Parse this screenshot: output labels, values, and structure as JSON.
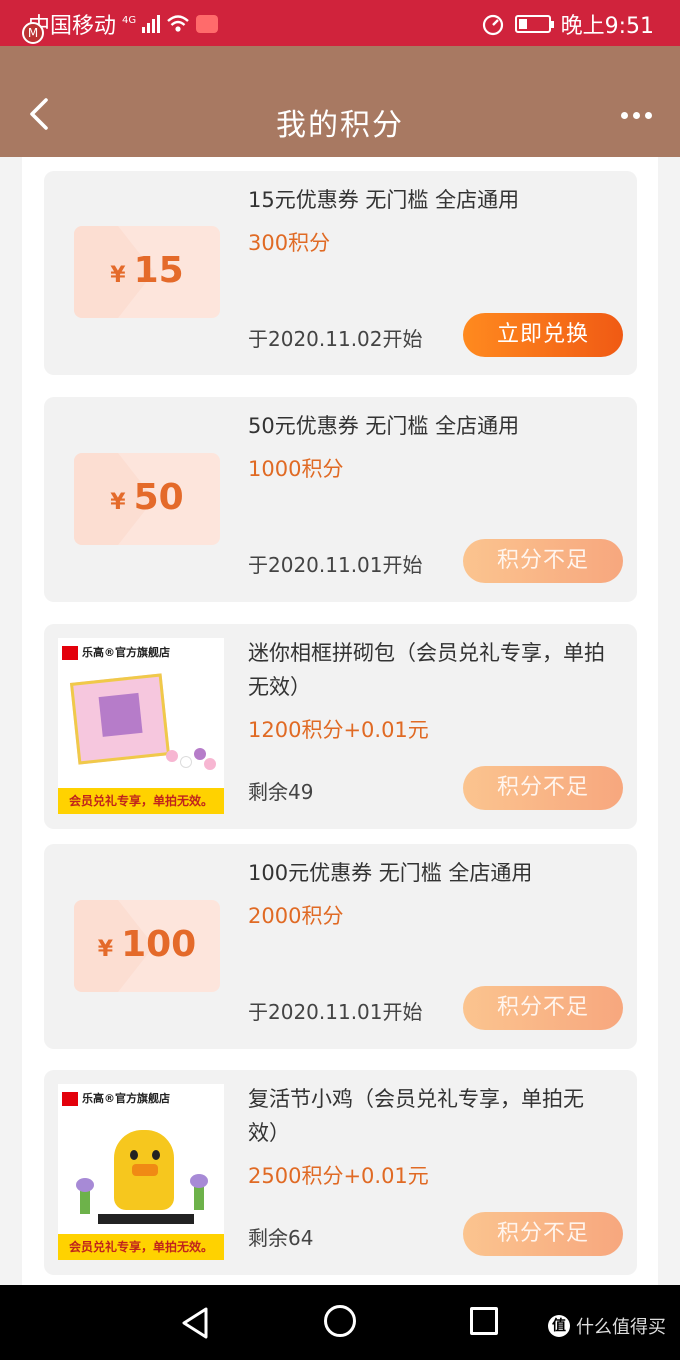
{
  "status_bar": {
    "carrier": "中国移动",
    "network": "4G",
    "time": "晚上9:51",
    "background_color": "#d0233c"
  },
  "header": {
    "title": "我的积分",
    "background_color": "#a87962"
  },
  "items": [
    {
      "kind": "coupon",
      "currency": "¥",
      "amount": "15",
      "title": "15元优惠券 无门槛 全店通用",
      "points": "300积分",
      "meta": "于2020.11.02开始",
      "button": "立即兑换",
      "button_state": "active"
    },
    {
      "kind": "coupon",
      "currency": "¥",
      "amount": "50",
      "title": "50元优惠券 无门槛 全店通用",
      "points": "1000积分",
      "meta": "于2020.11.01开始",
      "button": "积分不足",
      "button_state": "disabled"
    },
    {
      "kind": "product",
      "store": "乐高®官方旗舰店",
      "banner": "会员兑礼专享，单拍无效。",
      "title": "迷你相框拼砌包（会员兑礼专享，单拍无效）",
      "points": "1200积分+0.01元",
      "meta": "剩余49",
      "button": "积分不足",
      "button_state": "disabled"
    },
    {
      "kind": "coupon",
      "currency": "¥",
      "amount": "100",
      "title": "100元优惠券 无门槛 全店通用",
      "points": "2000积分",
      "meta": "于2020.11.01开始",
      "button": "积分不足",
      "button_state": "disabled"
    },
    {
      "kind": "product",
      "store": "乐高®官方旗舰店",
      "banner": "会员兑礼专享，单拍无效。",
      "title": "复活节小鸡（会员兑礼专享，单拍无效）",
      "points": "2500积分+0.01元",
      "meta": "剩余64",
      "button": "积分不足",
      "button_state": "disabled"
    }
  ],
  "watermark": {
    "icon_text": "值",
    "text": "什么值得买"
  },
  "colors": {
    "points_orange": "#e06a24",
    "button_active": "#f05a14",
    "button_disabled": "#f7a77e"
  }
}
